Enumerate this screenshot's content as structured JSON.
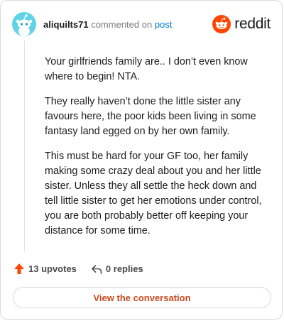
{
  "header": {
    "username": "aliquilts71",
    "action_text": "commented on",
    "post_link": "post",
    "brand": "reddit"
  },
  "comment": {
    "paragraphs": [
      "Your girlfriends family are.. I don’t even know where to begin! NTA.",
      "They really haven’t done the little sister any favours here, the poor kids been living in some fantasy land egged on by her own family.",
      "This must be hard for your GF too, her family making some crazy deal about you and her little sister. Unless they all settle the heck down and tell little sister to get her emotions under control, you are both probably better off keeping your distance for some time."
    ]
  },
  "actions": {
    "upvotes": "13 upvotes",
    "replies": "0 replies"
  },
  "cta": {
    "label": "View the conversation"
  },
  "colors": {
    "brand_orange": "#ff4500",
    "upvote": "#ff4500",
    "cta_text": "#c8491f",
    "link": "#0079d3",
    "avatar_bg": "#5fd3e8"
  },
  "icons": {
    "avatar": "snoo-avatar",
    "brand": "reddit-logo-icon",
    "upvote": "upvote-arrow-icon",
    "reply": "reply-arrow-icon"
  }
}
